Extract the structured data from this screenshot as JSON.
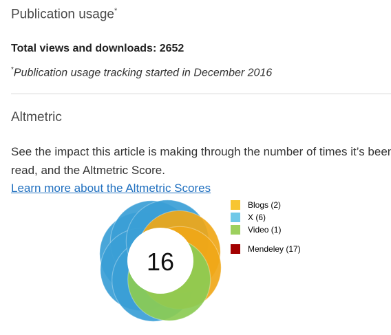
{
  "publication_usage": {
    "title": "Publication usage",
    "title_marker": "*",
    "total_label": "Total views and downloads: 2652",
    "note_marker": "*",
    "note": "Publication usage tracking started in December 2016"
  },
  "altmetric": {
    "title": "Altmetric",
    "description_line1": "See the impact this article is making through the number of times it’s been",
    "description_line2": "read, and the Altmetric Score.",
    "learn_more_link": "Learn more about the Altmetric Scores",
    "score": "16",
    "legend": [
      {
        "label": "Blogs (2)",
        "color": "#f7c531",
        "count": 2
      },
      {
        "label": "X (6)",
        "color": "#6fc8e8",
        "count": 6
      },
      {
        "label": "Video (1)",
        "color": "#9dd05e",
        "count": 1
      },
      {
        "label": "Mendeley (17)",
        "color": "#a30000",
        "count": 17
      }
    ],
    "donut_colors": {
      "blogs": "#f0a818",
      "x": "#3a9fd6",
      "video": "#8ccc54"
    }
  }
}
